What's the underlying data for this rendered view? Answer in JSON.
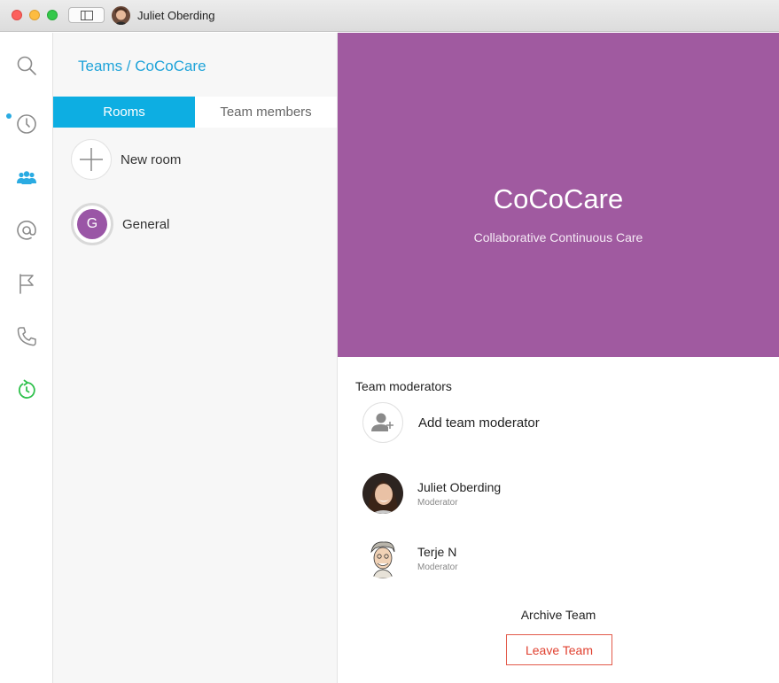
{
  "window": {
    "user_name": "Juliet Oberding"
  },
  "rail": {
    "icons": [
      "search-icon",
      "recents-icon",
      "teams-icon",
      "mentions-icon",
      "flag-icon",
      "calls-icon",
      "meetings-icon"
    ],
    "accent": "#2aabe2",
    "meetings_color": "#2fc14c"
  },
  "teams_panel": {
    "breadcrumb": "Teams / CoCoCare",
    "tabs": [
      {
        "label": "Rooms",
        "active": true
      },
      {
        "label": "Team members",
        "active": false
      }
    ],
    "new_room_label": "New room",
    "rooms": [
      {
        "initial": "G",
        "name": "General",
        "color": "#9a56a6"
      }
    ]
  },
  "hero": {
    "title": "CoCoCare",
    "subtitle": "Collaborative Continuous Care",
    "color": "#a05aa0"
  },
  "moderators": {
    "section_title": "Team moderators",
    "add_label": "Add team moderator",
    "members": [
      {
        "name": "Juliet Oberding",
        "role": "Moderator"
      },
      {
        "name": "Terje N",
        "role": "Moderator"
      }
    ]
  },
  "actions": {
    "archive_label": "Archive Team",
    "leave_label": "Leave Team",
    "leave_color": "#e0402f"
  }
}
